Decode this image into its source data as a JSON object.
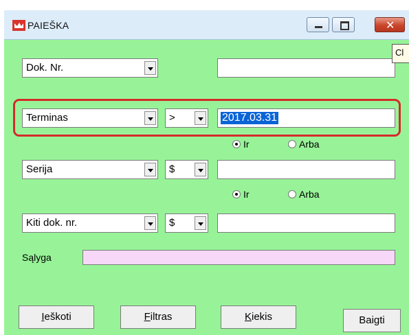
{
  "window": {
    "title": "PAIEŠKA"
  },
  "tooltip_edge_text": "Cl",
  "rows": {
    "dok": {
      "field": "Dok. Nr.",
      "value": ""
    },
    "terminas": {
      "field": "Terminas",
      "operator": ">",
      "value": "2017.03.31"
    },
    "radio1": {
      "ir": "Ir",
      "arba": "Arba",
      "selected": "Ir"
    },
    "serija": {
      "field": "Serija",
      "operator": "$",
      "value": ""
    },
    "radio2": {
      "ir": "Ir",
      "arba": "Arba",
      "selected": "Ir"
    },
    "kiti": {
      "field": "Kiti dok. nr.",
      "operator": "$",
      "value": ""
    }
  },
  "condition": {
    "label": "Sąlyga",
    "value": ""
  },
  "buttons": {
    "search": {
      "mnemonic": "I",
      "rest": "eškoti"
    },
    "filter": {
      "mnemonic": "F",
      "rest": "iltras"
    },
    "count": {
      "mnemonic": "K",
      "rest": "iekis"
    },
    "finish": "Baigti"
  },
  "colors": {
    "window_bg": "#98f398",
    "highlight": "#d42a2a",
    "selection": "#0a64d6",
    "condition_bg": "#f8d8f8"
  }
}
